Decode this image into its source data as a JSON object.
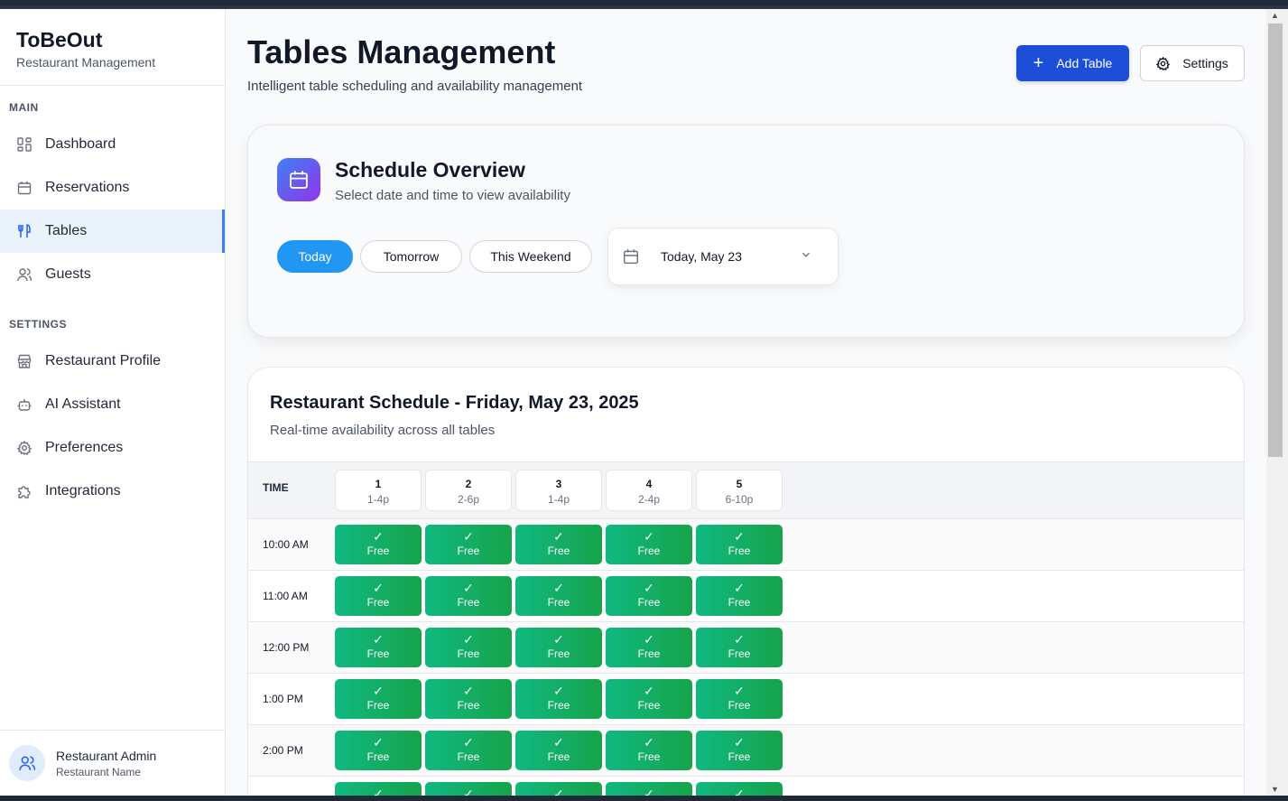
{
  "brand": {
    "title": "ToBeOut",
    "subtitle": "Restaurant Management"
  },
  "sidebar": {
    "main_label": "MAIN",
    "settings_label": "SETTINGS",
    "main_items": [
      {
        "label": "Dashboard",
        "icon": "grid-icon"
      },
      {
        "label": "Reservations",
        "icon": "calendar-icon"
      },
      {
        "label": "Tables",
        "icon": "utensils-icon",
        "active": true
      },
      {
        "label": "Guests",
        "icon": "users-icon"
      }
    ],
    "settings_items": [
      {
        "label": "Restaurant Profile",
        "icon": "store-icon"
      },
      {
        "label": "AI Assistant",
        "icon": "bot-icon"
      },
      {
        "label": "Preferences",
        "icon": "gear-icon"
      },
      {
        "label": "Integrations",
        "icon": "puzzle-icon"
      }
    ],
    "user": {
      "name": "Restaurant Admin",
      "subtitle": "Restaurant Name"
    }
  },
  "header": {
    "title": "Tables Management",
    "subtitle": "Intelligent table scheduling and availability management",
    "add_label": "Add Table",
    "settings_label": "Settings"
  },
  "overview": {
    "title": "Schedule Overview",
    "subtitle": "Select date and time to view availability",
    "filters": [
      "Today",
      "Tomorrow",
      "This Weekend"
    ],
    "active_filter": "Today",
    "date_value": "Today, May 23"
  },
  "schedule": {
    "title": "Restaurant Schedule - Friday, May 23, 2025",
    "subtitle": "Real-time availability across all tables",
    "time_header": "TIME",
    "tables": [
      {
        "number": "1",
        "hours": "1-4p"
      },
      {
        "number": "2",
        "hours": "2-6p"
      },
      {
        "number": "3",
        "hours": "1-4p"
      },
      {
        "number": "4",
        "hours": "2-4p"
      },
      {
        "number": "5",
        "hours": "6-10p"
      }
    ],
    "rows": [
      {
        "time": "10:00 AM",
        "status": "Free"
      },
      {
        "time": "11:00 AM",
        "status": "Free"
      },
      {
        "time": "12:00 PM",
        "status": "Free"
      },
      {
        "time": "1:00 PM",
        "status": "Free"
      },
      {
        "time": "2:00 PM",
        "status": "Free"
      },
      {
        "time": "",
        "status": "Free"
      }
    ],
    "status_mark": "✓",
    "free_color": "#16a34a"
  }
}
